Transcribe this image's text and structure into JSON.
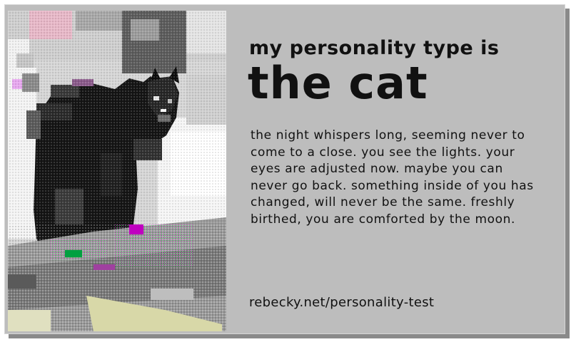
{
  "result": {
    "subtitle": "my personality type is",
    "title": "the cat",
    "description": "the night whispers long, seeming never to come to a close. you see the lights. your eyes are adjusted now. maybe you can never go back. something inside of you has changed, will never be the same. freshly birthed, you are comforted by the moon.",
    "site_url": "rebecky.net/personality-test"
  },
  "colors": {
    "card_background": "#bdbdbd",
    "shadow": "#8a8a8a",
    "text": "#111111"
  }
}
